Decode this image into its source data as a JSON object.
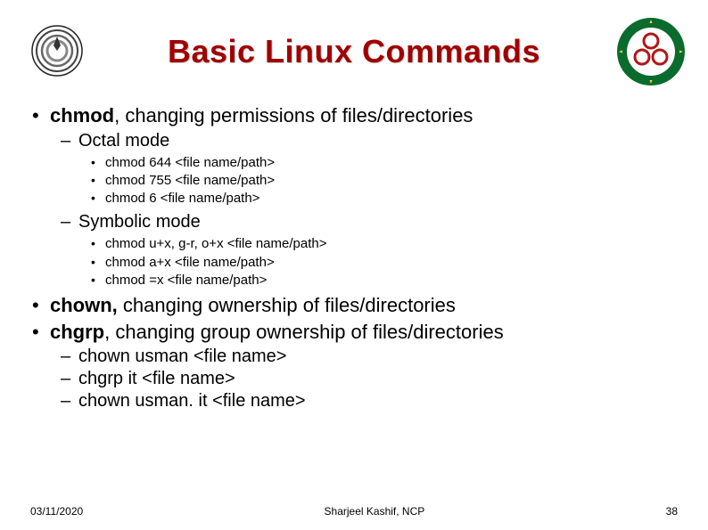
{
  "title": "Basic Linux Commands",
  "logo_left_caption": "",
  "bullets": [
    {
      "cmd": "chmod",
      "sep": ", ",
      "desc": "changing permissions of files/directories",
      "sub": [
        {
          "label": "Octal mode",
          "items": [
            "chmod 644 <file name/path>",
            "chmod 755 <file name/path>",
            "chmod 6 <file name/path>"
          ]
        },
        {
          "label": "Symbolic mode",
          "items": [
            "chmod u+x, g-r, o+x <file name/path>",
            "chmod a+x <file name/path>",
            "chmod =x <file name/path>"
          ]
        }
      ]
    },
    {
      "cmd": "chown,",
      "sep": " ",
      "desc": "changing ownership of files/directories",
      "sub": []
    },
    {
      "cmd": "chgrp",
      "sep": ", ",
      "desc": "changing group ownership of files/directories",
      "sub": [
        {
          "label": "chown usman <file name>",
          "items": []
        },
        {
          "label": "chgrp it <file name>",
          "items": []
        },
        {
          "label": "chown usman. it <file name>",
          "items": []
        }
      ]
    }
  ],
  "footer": {
    "date": "03/11/2020",
    "author": "Sharjeel Kashif, NCP",
    "page": "38"
  },
  "colors": {
    "title": "#a00000",
    "seal_green": "#0a6b2d",
    "seal_red": "#b01818"
  }
}
